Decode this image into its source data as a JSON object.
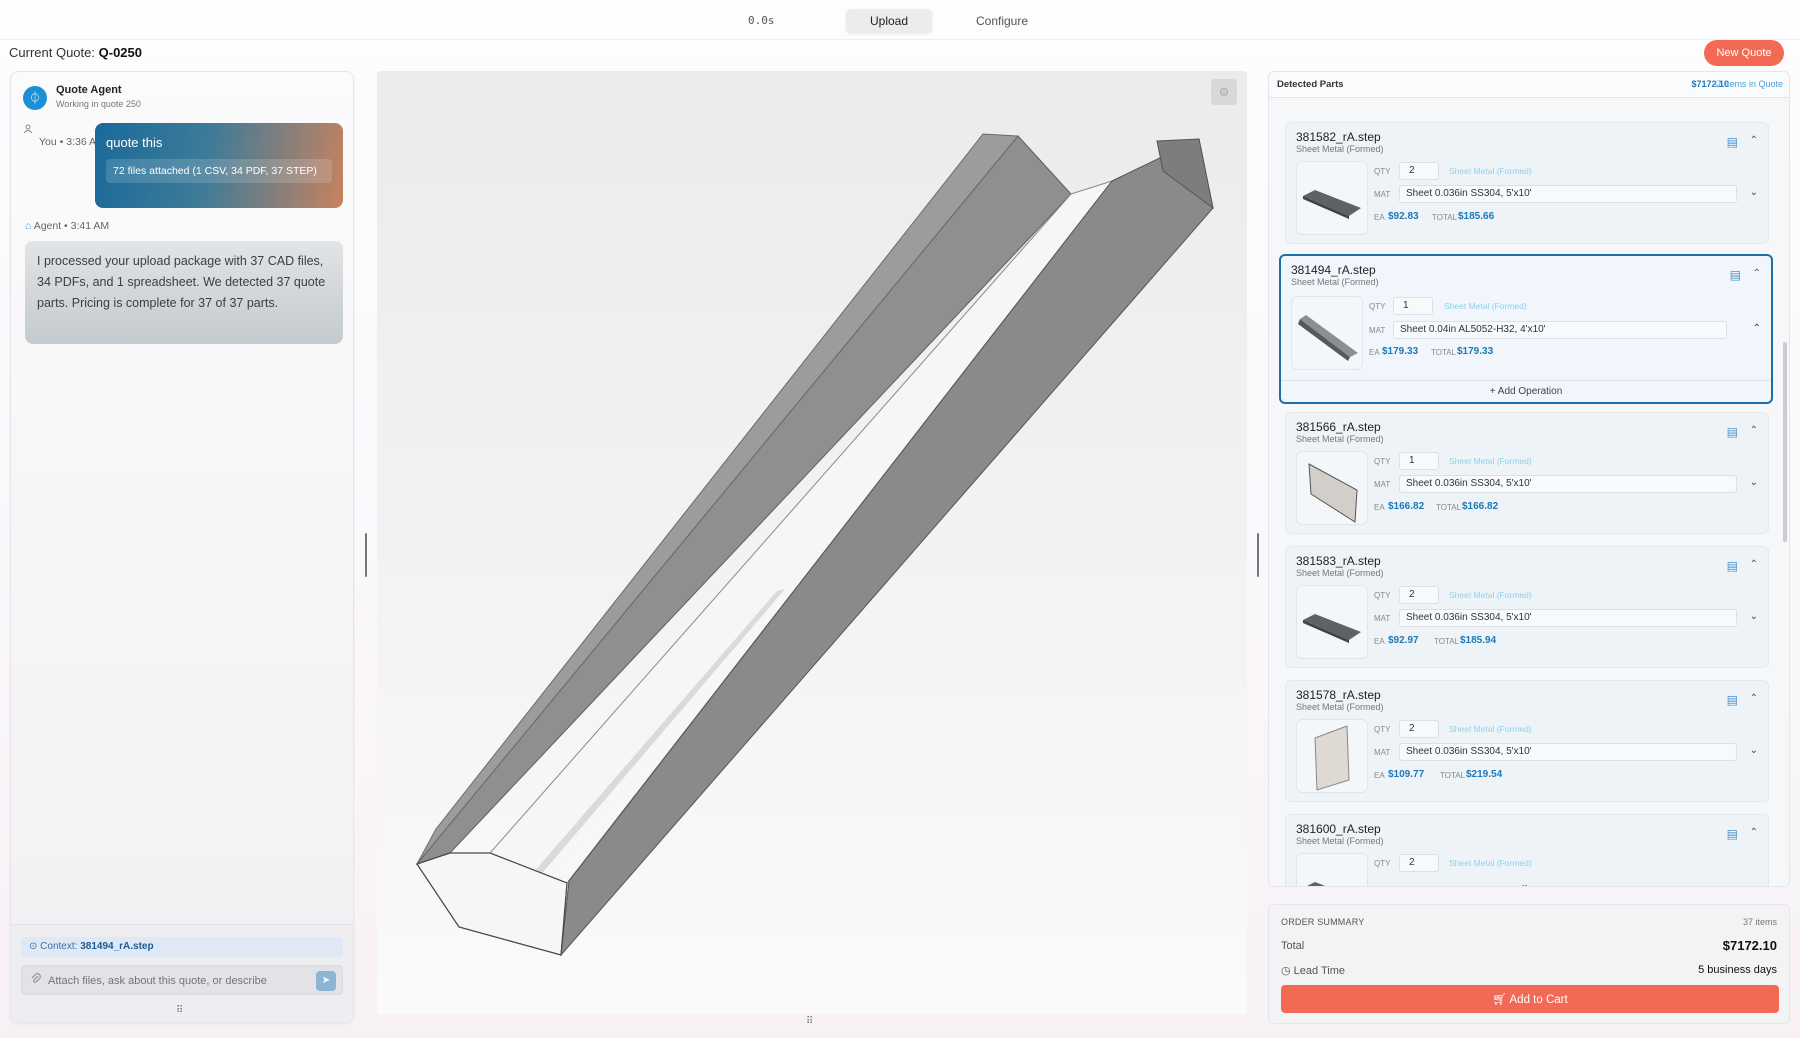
{
  "topbar": {
    "timer": "0.0s",
    "tabs": [
      {
        "label": "Upload",
        "active": true
      },
      {
        "label": "Configure",
        "active": false
      }
    ]
  },
  "quote": {
    "label": "Current Quote:",
    "id": "Q-0250",
    "new_quote_label": "New Quote"
  },
  "chat": {
    "agent_name": "Quote Agent",
    "agent_sub": "Working in quote 250",
    "user_meta": "You • 3:36 AM",
    "user_message": "quote this",
    "user_attachment": "72 files attached (1 CSV, 34 PDF, 37 STEP)",
    "agent_meta": "Agent • 3:41 AM",
    "agent_message": "I processed your upload package with 37 CAD files, 34 PDFs, and 1 spreadsheet. We detected 37 quote parts. Pricing is complete for 37 of 37 parts.",
    "context_label": "Context:",
    "context_value": "381494_rA.step",
    "input_placeholder": "Attach files, ask about this quote, or describe"
  },
  "parts_panel": {
    "title": "Detected Parts",
    "total": "$7172.10",
    "count": "37 Items in Quote",
    "labels": {
      "qty": "QTY",
      "mat": "MAT",
      "ea": "EA",
      "total": "TOTAL",
      "add_operation": "+ Add Operation"
    },
    "parts": [
      {
        "name": "381582_rA.step",
        "type": "Sheet Metal (Formed)",
        "qty": "2",
        "process": "Sheet Metal (Formed)",
        "material": "Sheet 0.036in SS304, 5'x10'",
        "ea": "$92.83",
        "total": "$185.66",
        "selected": false,
        "thumb": "flat-bar-dark"
      },
      {
        "name": "381494_rA.step",
        "type": "Sheet Metal (Formed)",
        "qty": "1",
        "process": "Sheet Metal (Formed)",
        "material": "Sheet 0.04in AL5052-H32, 4'x10'",
        "ea": "$179.33",
        "total": "$179.33",
        "selected": true,
        "thumb": "channel"
      },
      {
        "name": "381566_rA.step",
        "type": "Sheet Metal (Formed)",
        "qty": "1",
        "process": "Sheet Metal (Formed)",
        "material": "Sheet 0.036in SS304, 5'x10'",
        "ea": "$166.82",
        "total": "$166.82",
        "selected": false,
        "thumb": "panel"
      },
      {
        "name": "381583_rA.step",
        "type": "Sheet Metal (Formed)",
        "qty": "2",
        "process": "Sheet Metal (Formed)",
        "material": "Sheet 0.036in SS304, 5'x10'",
        "ea": "$92.97",
        "total": "$185.94",
        "selected": false,
        "thumb": "flat-bar-dark"
      },
      {
        "name": "381578_rA.step",
        "type": "Sheet Metal (Formed)",
        "qty": "2",
        "process": "Sheet Metal (Formed)",
        "material": "Sheet 0.036in SS304, 5'x10'",
        "ea": "$109.77",
        "total": "$219.54",
        "selected": false,
        "thumb": "panel-light"
      },
      {
        "name": "381600_rA.step",
        "type": "Sheet Metal (Formed)",
        "qty": "2",
        "process": "Sheet Metal (Formed)",
        "selected": false,
        "thumb": "flat-bar-dark"
      }
    ]
  },
  "summary": {
    "title": "ORDER SUMMARY",
    "items": "37 items",
    "total_label": "Total",
    "total_value": "$7172.10",
    "lead_label": "Lead Time",
    "lead_value": "5 business days",
    "add_to_cart": "Add to Cart"
  },
  "colors": {
    "accent": "#f26a55",
    "primary_blue": "#1d6fa9",
    "price_blue": "#1d79b8"
  },
  "icons": {
    "agent": "agent-icon",
    "user": "user-icon",
    "attach": "paperclip-icon",
    "send": "send-icon",
    "doc": "document-icon",
    "collapse": "chevron-up-icon",
    "dropdown": "chevron-down-icon",
    "clock": "clock-icon",
    "cart": "cart-icon"
  }
}
